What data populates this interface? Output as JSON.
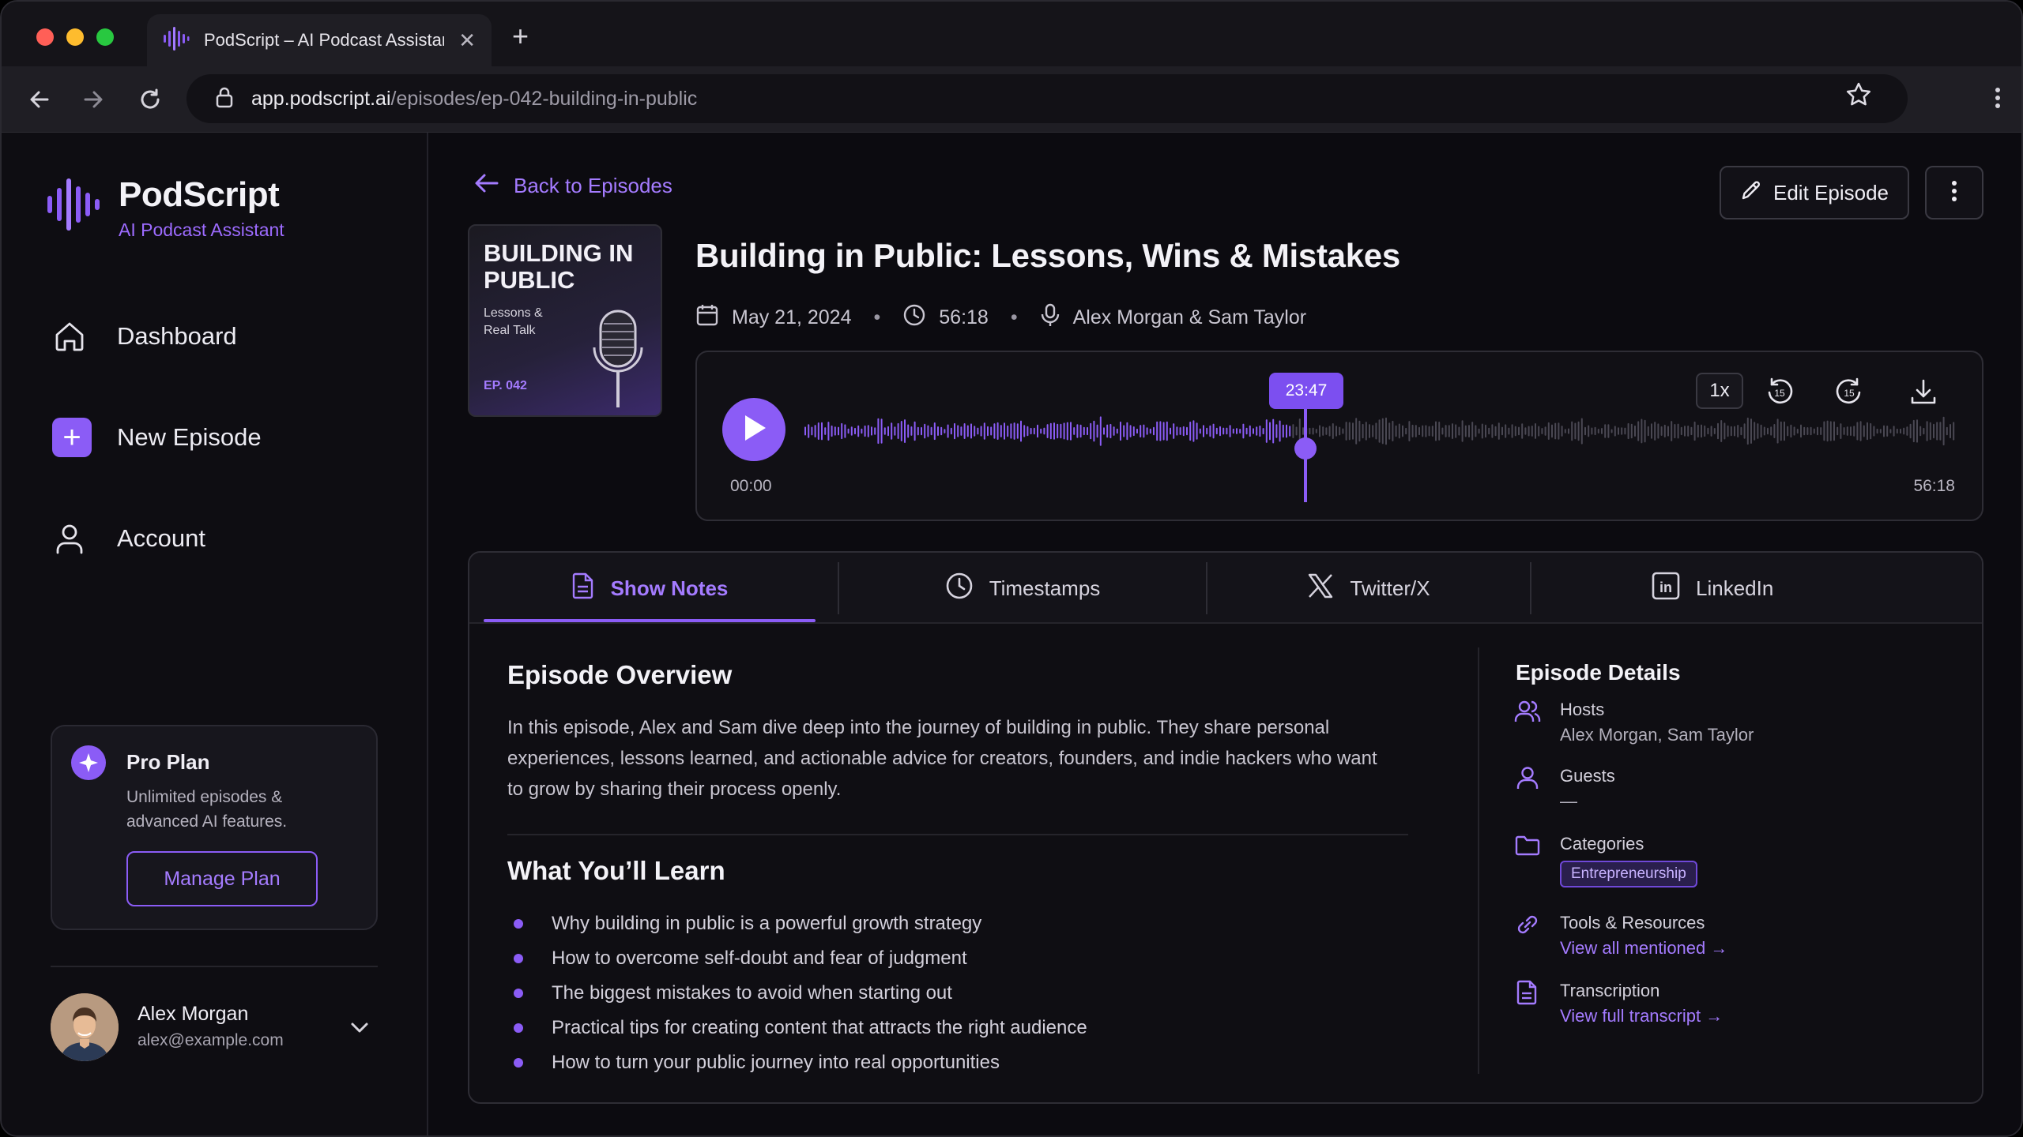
{
  "browser": {
    "tab_title": "PodScript – AI Podcast Assistant",
    "url_domain": "app.podscript.ai",
    "url_path": "/episodes/ep-042-building-in-public"
  },
  "sidebar": {
    "brand_name": "PodScript",
    "brand_tagline": "AI Podcast Assistant",
    "nav": [
      {
        "label": "Dashboard",
        "icon": "home-icon"
      },
      {
        "label": "New Episode",
        "icon": "plus-icon"
      },
      {
        "label": "Account",
        "icon": "user-icon"
      }
    ],
    "plan": {
      "title": "Pro Plan",
      "description": "Unlimited episodes & advanced AI features.",
      "button": "Manage Plan"
    },
    "user": {
      "name": "Alex Morgan",
      "email": "alex@example.com"
    }
  },
  "episode": {
    "back_label": "Back to Episodes",
    "edit_label": "Edit Episode",
    "cover": {
      "title": "BUILDING IN PUBLIC",
      "subtitle": "Lessons & Real Talk",
      "ep_label": "EP. 042"
    },
    "title": "Building in Public: Lessons, Wins & Mistakes",
    "date": "May 21, 2024",
    "duration": "56:18",
    "hosts": "Alex Morgan & Sam Taylor"
  },
  "player": {
    "current_time": "23:47",
    "start_time": "00:00",
    "end_time": "56:18",
    "speed": "1x",
    "progress": 0.422,
    "accent": "#8b5cf6"
  },
  "tabs": [
    {
      "label": "Show Notes",
      "icon": "document-icon",
      "active": true
    },
    {
      "label": "Timestamps",
      "icon": "clock-icon",
      "active": false
    },
    {
      "label": "Twitter/X",
      "icon": "x-logo-icon",
      "active": false
    },
    {
      "label": "LinkedIn",
      "icon": "linkedin-icon",
      "active": false
    }
  ],
  "show_notes": {
    "overview_title": "Episode Overview",
    "overview_text": "In this episode, Alex and Sam dive deep into the journey of building in public. They share personal experiences, lessons learned, and actionable advice for creators, founders, and indie hackers who want to grow by sharing their process openly.",
    "learn_title": "What You’ll Learn",
    "learn_items": [
      "Why building in public is a powerful growth strategy",
      "How to overcome self-doubt and fear of judgment",
      "The biggest mistakes to avoid when starting out",
      "Practical tips for creating content that attracts the right audience",
      "How to turn your public journey into real opportunities"
    ]
  },
  "details": {
    "title": "Episode Details",
    "hosts_label": "Hosts",
    "hosts_value": "Alex Morgan, Sam Taylor",
    "guests_label": "Guests",
    "guests_value": "—",
    "categories_label": "Categories",
    "category_chip": "Entrepreneurship",
    "tools_label": "Tools & Resources",
    "tools_link": "View all mentioned →",
    "transcription_label": "Transcription",
    "transcription_link": "View full transcript →"
  }
}
